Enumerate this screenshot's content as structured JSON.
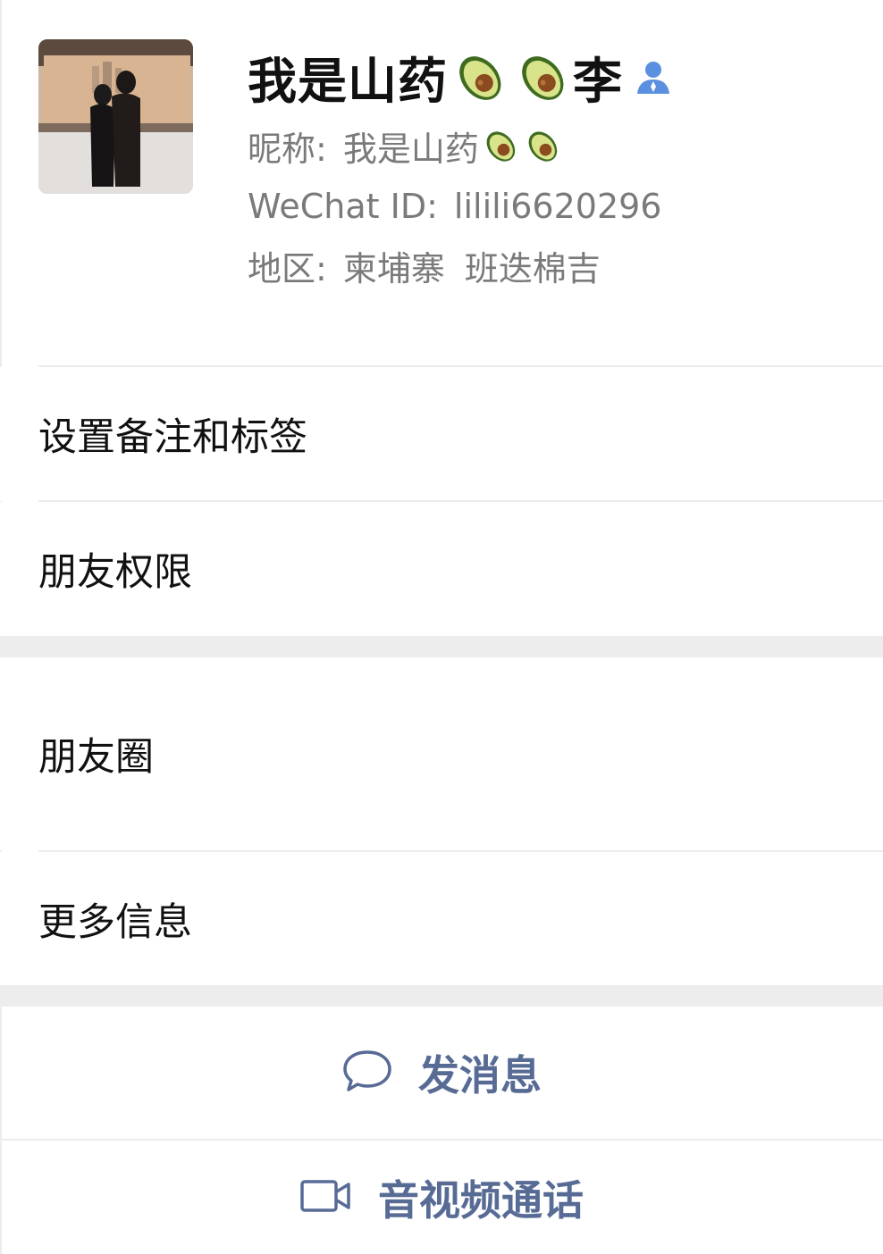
{
  "profile": {
    "name_part1": "我是山药",
    "name_part2": "李",
    "nickname_label": "昵称:",
    "nickname_value": "我是山药",
    "wechat_id_label": "WeChat ID:",
    "wechat_id_value": "lilili6620296",
    "region_label": "地区:",
    "region_country": "柬埔寨",
    "region_city": "班迭棉吉",
    "emoji_icons": [
      "avocado-icon",
      "avocado-icon"
    ],
    "contact_icon": "contact-person-icon",
    "contact_icon_color": "#5b8fe0"
  },
  "menu": {
    "remark_tags": "设置备注和标签",
    "friend_permissions": "朋友权限",
    "moments": "朋友圈",
    "more_info": "更多信息"
  },
  "actions": {
    "send_message": "发消息",
    "video_call": "音视频通话",
    "accent_color": "#576b95"
  }
}
